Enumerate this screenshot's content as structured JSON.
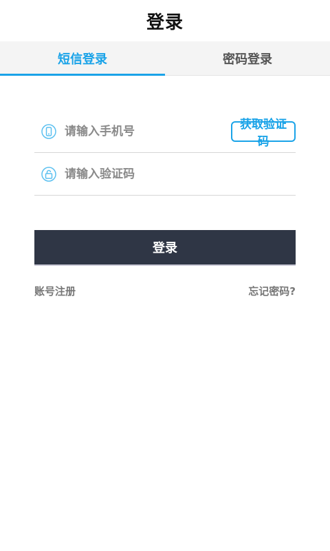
{
  "header": {
    "title": "登录"
  },
  "tabs": [
    {
      "label": "短信登录",
      "active": true
    },
    {
      "label": "密码登录",
      "active": false
    }
  ],
  "form": {
    "phone_placeholder": "请输入手机号",
    "code_placeholder": "请输入验证码",
    "get_code_label": "获取验证码",
    "login_label": "登录"
  },
  "links": {
    "register": "账号注册",
    "forgot": "忘记密码?"
  },
  "colors": {
    "accent": "#1aa3e8",
    "button": "#2f3645",
    "icon": "#5bc0f0"
  },
  "icons": {
    "phone": "phone-icon",
    "lock": "lock-icon"
  }
}
